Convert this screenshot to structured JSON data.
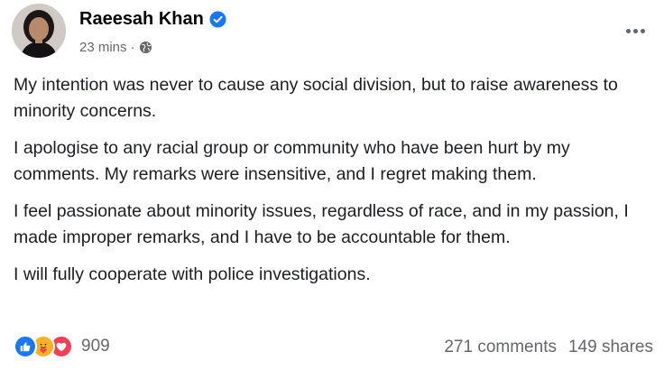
{
  "post": {
    "author": "Raeesah Khan",
    "time": "23 mins",
    "separator": "·",
    "audience_icon": "globe-icon",
    "verified_icon": "verified-badge-icon",
    "more_icon": "more-options-icon",
    "paragraphs": [
      "My intention was never to cause any social division, but to raise awareness to minority concerns.",
      "I apologise to any racial group or community who have been hurt by my comments. My remarks were insensitive, and I regret making them.",
      "I feel passionate about minority issues, regardless of race, and in my passion, I made improper remarks, and I have to be accountable for them.",
      "I will fully cooperate with police investigations."
    ]
  },
  "footer": {
    "reaction_icons": [
      "like-icon",
      "care-icon",
      "love-icon"
    ],
    "reaction_count": "909",
    "comments": "271 comments",
    "shares": "149 shares"
  },
  "colors": {
    "like": "#1877f2",
    "care": "#f7b125",
    "love": "#f33e58",
    "verified": "#1877f2",
    "secondary_text": "#65676b"
  }
}
